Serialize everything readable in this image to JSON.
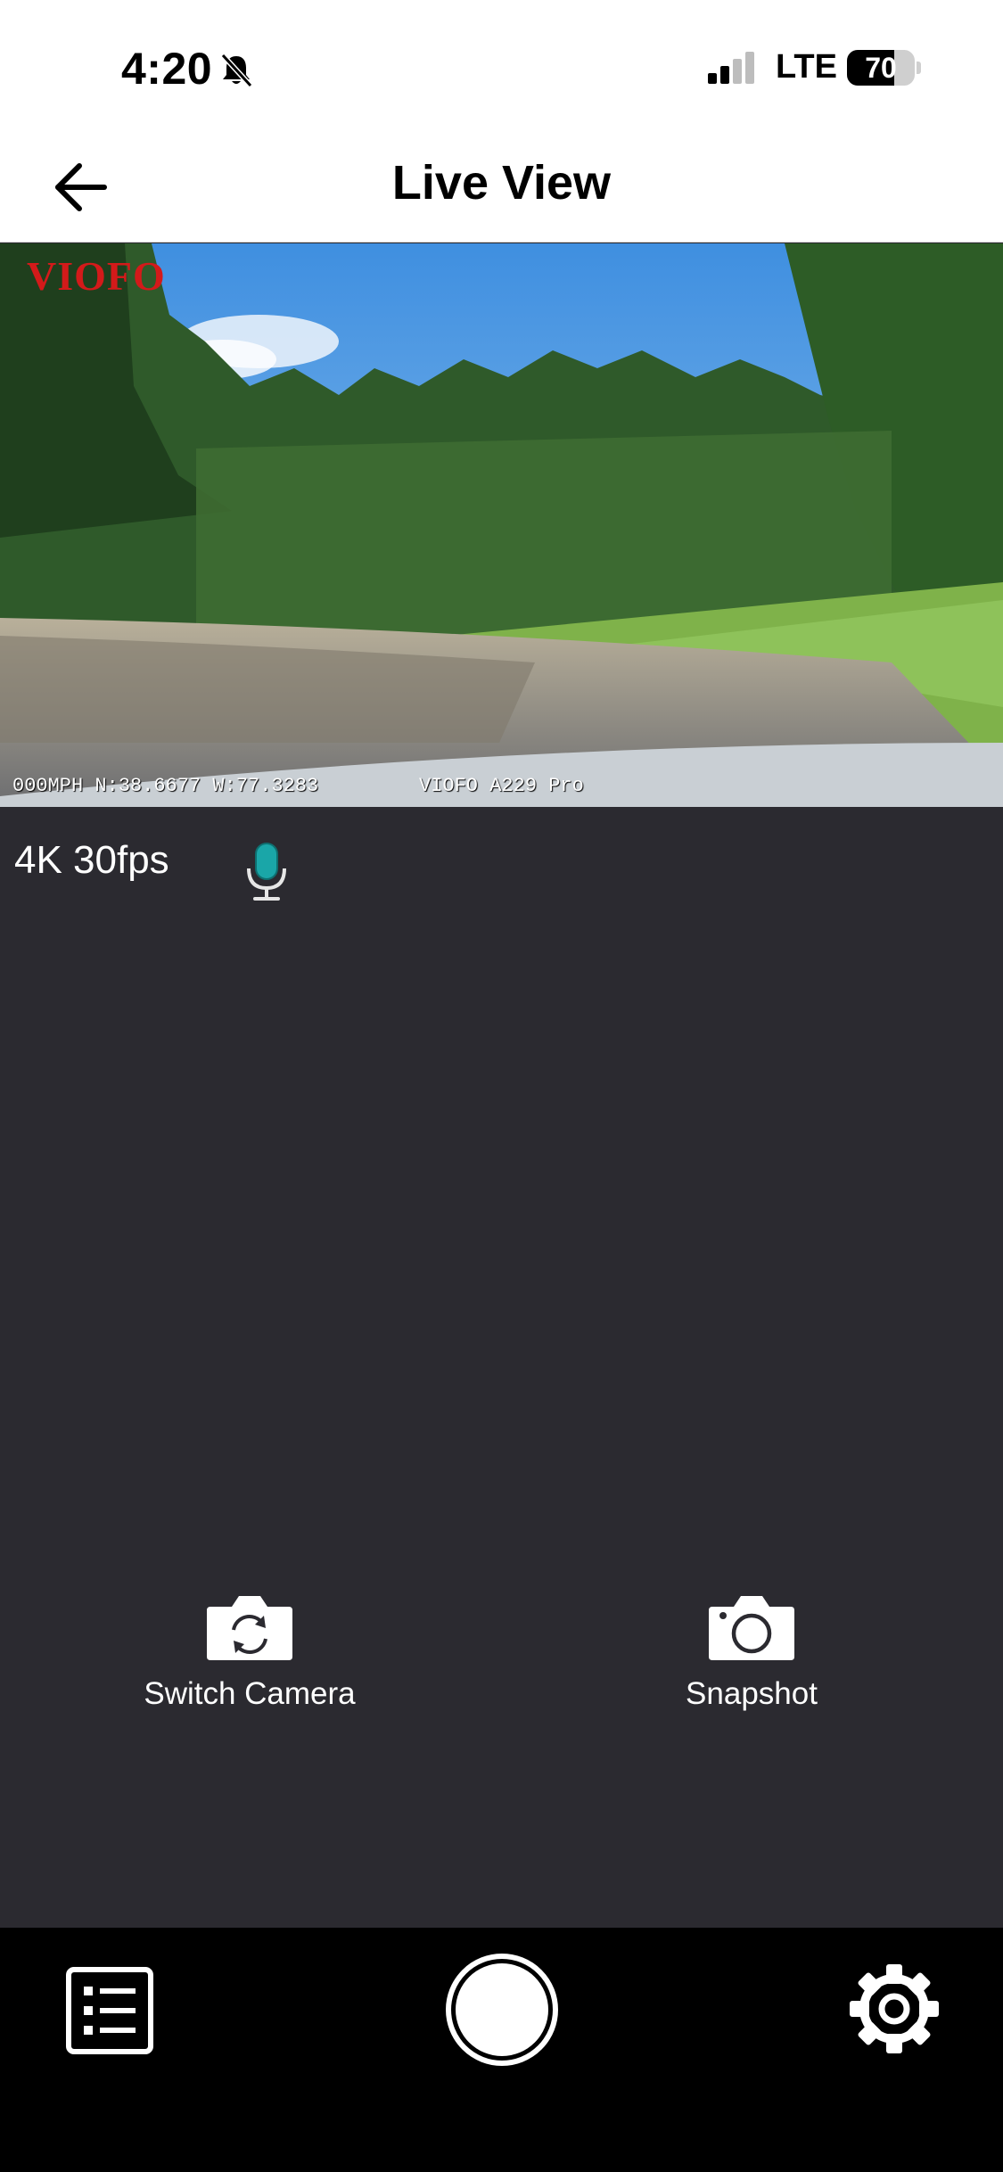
{
  "status_bar": {
    "time": "4:20",
    "network": "LTE",
    "battery_level": 70,
    "battery_text": "70"
  },
  "nav": {
    "title": "Live View",
    "back_icon": "arrow-left-icon"
  },
  "camera_feed": {
    "brand_watermark": "VIOFO",
    "overlay_gps": "000MPH N:38.6677 W:77.3283",
    "overlay_model": "VIOFO A229 Pro"
  },
  "stream_info": {
    "resolution": "4K 30fps",
    "mic_icon": "microphone-icon",
    "mic_color": "#1aa6a8"
  },
  "actions": {
    "switch_camera_label": "Switch Camera",
    "snapshot_label": "Snapshot"
  },
  "toolbar": {
    "files_icon": "list-icon",
    "record_icon": "record-circle-icon",
    "settings_icon": "gear-icon"
  },
  "colors": {
    "background": "#2b2a30",
    "toolbar": "#000000",
    "brand_red": "#d31a1a"
  }
}
